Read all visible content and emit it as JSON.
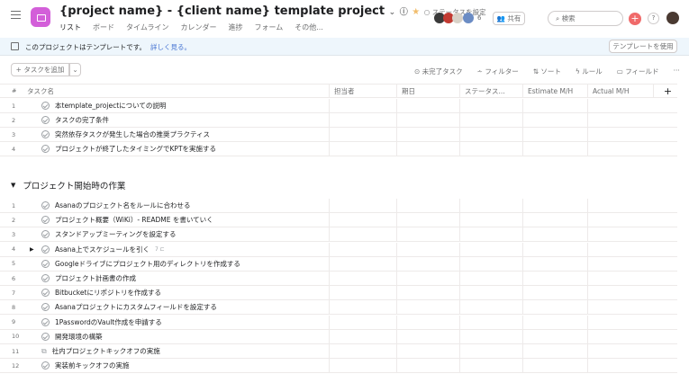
{
  "header": {
    "title": "{project name} - {client name} template project",
    "status_label": "ステータスを設定",
    "member_count": "6",
    "share_label": "共有",
    "search_placeholder": "検索",
    "help": "?"
  },
  "tabs": [
    {
      "label": "リスト",
      "active": true
    },
    {
      "label": "ボード"
    },
    {
      "label": "タイムライン"
    },
    {
      "label": "カレンダー"
    },
    {
      "label": "進捗"
    },
    {
      "label": "フォーム"
    },
    {
      "label": "その他..."
    }
  ],
  "banner": {
    "text": "このプロジェクトはテンプレートです。",
    "link": "詳しく見る。",
    "button": "テンプレートを使用"
  },
  "toolbar": {
    "add_task": "+ タスクを追加",
    "incomplete": "未完了タスク",
    "filter": "フィルター",
    "sort": "ソート",
    "rules": "ルール",
    "fields": "フィールド",
    "more": "···"
  },
  "columns": {
    "num": "#",
    "name": "タスク名",
    "assignee": "担当者",
    "due": "期日",
    "status": "ステータス...",
    "estimate": "Estimate M/H",
    "actual": "Actual M/H",
    "add": "+"
  },
  "tasks": [
    {
      "n": "1",
      "name": "本template_projectについての説明"
    },
    {
      "n": "2",
      "name": "タスクの完了条件"
    },
    {
      "n": "3",
      "name": "突然依存タスクが発生した場合の推奨プラクティス"
    },
    {
      "n": "4",
      "name": "プロジェクトが終了したタイミングでKPTを実施する"
    }
  ],
  "section": {
    "title": "プロジェクト開始時の作業",
    "tasks": [
      {
        "n": "1",
        "name": "Asanaのプロジェクト名をルールに合わせる"
      },
      {
        "n": "2",
        "name": "プロジェクト概要（WiKi）- README を書いていく"
      },
      {
        "n": "3",
        "name": "スタンドアップミーティングを設定する"
      },
      {
        "n": "4",
        "name": "Asana上でスケジュールを引く",
        "subtasks": "7 ⊏"
      },
      {
        "n": "5",
        "name": "Googleドライブにプロジェクト用のディレクトリを作成する"
      },
      {
        "n": "6",
        "name": "プロジェクト計画書の作成"
      },
      {
        "n": "7",
        "name": "Bitbucketにリポジトリを作成する"
      },
      {
        "n": "8",
        "name": "Asanaプロジェクトにカスタムフィールドを設定する"
      },
      {
        "n": "9",
        "name": "1PasswordのVault作成を申請する"
      },
      {
        "n": "10",
        "name": "開発環境の構築"
      },
      {
        "n": "11",
        "name": "社内プロジェクトキックオフの実施",
        "milestone": true
      },
      {
        "n": "12",
        "name": "実装前キックオフの実施"
      }
    ]
  },
  "colors": {
    "brand": "#d35fd9",
    "accent": "#4573d2",
    "add_button": "#f06a6a"
  }
}
